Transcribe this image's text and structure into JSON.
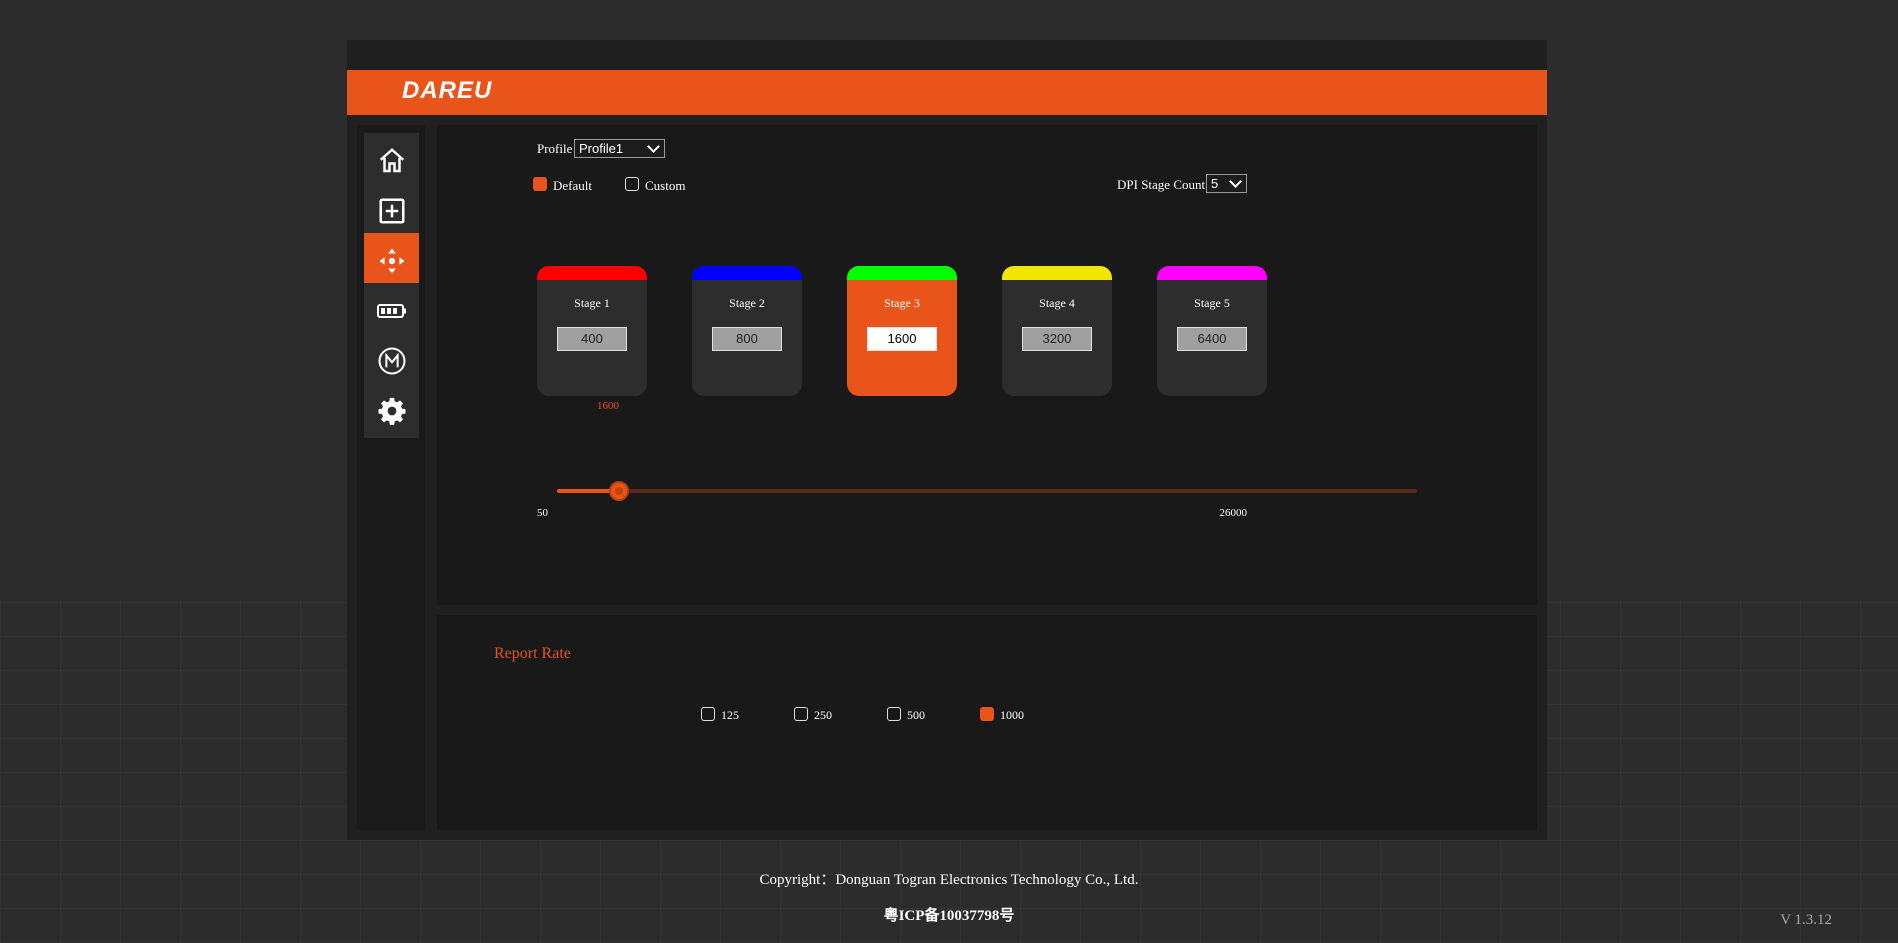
{
  "brand": {
    "logo_text": "DAREU",
    "accent_color": "#e8541a"
  },
  "sidebar": {
    "items": [
      {
        "name": "home",
        "icon": "home-icon",
        "active": false
      },
      {
        "name": "macro",
        "icon": "plus-square-icon",
        "active": false
      },
      {
        "name": "dpi",
        "icon": "dpi-arrows-icon",
        "active": true
      },
      {
        "name": "battery",
        "icon": "battery-icon",
        "active": false
      },
      {
        "name": "mode",
        "icon": "m-circle-icon",
        "active": false
      },
      {
        "name": "settings",
        "icon": "gear-icon",
        "active": false
      }
    ]
  },
  "profile": {
    "label": "Profile",
    "selected": "Profile1"
  },
  "mode": {
    "default_label": "Default",
    "custom_label": "Custom",
    "selected": "Default"
  },
  "dpi_stage_count": {
    "label": "DPI Stage Count",
    "selected": "5"
  },
  "stages": [
    {
      "label": "Stage 1",
      "value": "400",
      "color": "#ff0000",
      "active": false
    },
    {
      "label": "Stage 2",
      "value": "800",
      "color": "#0000ff",
      "active": false
    },
    {
      "label": "Stage 3",
      "value": "1600",
      "color": "#00ff00",
      "active": true
    },
    {
      "label": "Stage 4",
      "value": "3200",
      "color": "#f2e600",
      "active": false
    },
    {
      "label": "Stage 5",
      "value": "6400",
      "color": "#ff00ff",
      "active": false
    }
  ],
  "slider": {
    "current_label": "1600",
    "current": 1600,
    "min_label": "50",
    "max_label": "26000",
    "min": 50,
    "max": 26000
  },
  "report_rate": {
    "title": "Report Rate",
    "options": [
      {
        "label": "125",
        "selected": false
      },
      {
        "label": "250",
        "selected": false
      },
      {
        "label": "500",
        "selected": false
      },
      {
        "label": "1000",
        "selected": true
      }
    ]
  },
  "footer": {
    "copyright": "Copyright：Donguan Togran Electronics Technology Co., Ltd.",
    "icp": "粤ICP备10037798号",
    "version": "V 1.3.12"
  }
}
